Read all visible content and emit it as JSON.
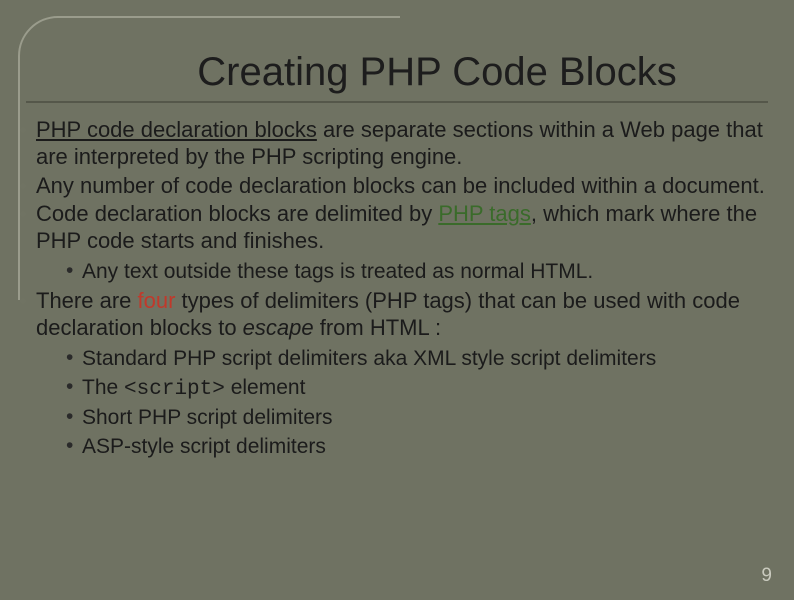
{
  "slide": {
    "title": "Creating PHP Code Blocks",
    "bullets": {
      "b1a": "PHP code declaration blocks",
      "b1b": " are separate sections within a Web page that are interpreted by the PHP scripting engine.",
      "b2": "Any number of code declaration blocks can be included within a document.",
      "b3a": "Code declaration blocks are delimited by ",
      "b3b": "PHP tags",
      "b3c": ", which mark where the PHP code starts and finishes.",
      "b3_sub1": "Any text outside these tags is treated as normal HTML.",
      "b4a": "There are ",
      "b4b": "four",
      "b4c": " types of delimiters (PHP tags) that can be used with code declaration blocks to ",
      "b4d": "escape",
      "b4e": " from HTML :",
      "b4_sub1": "Standard PHP script delimiters aka XML style script delimiters",
      "b4_sub2a": "The ",
      "b4_sub2b": "<script>",
      "b4_sub2c": " element",
      "b4_sub3": "Short PHP script delimiters",
      "b4_sub4": "ASP-style script delimiters"
    },
    "page_number": "9"
  }
}
